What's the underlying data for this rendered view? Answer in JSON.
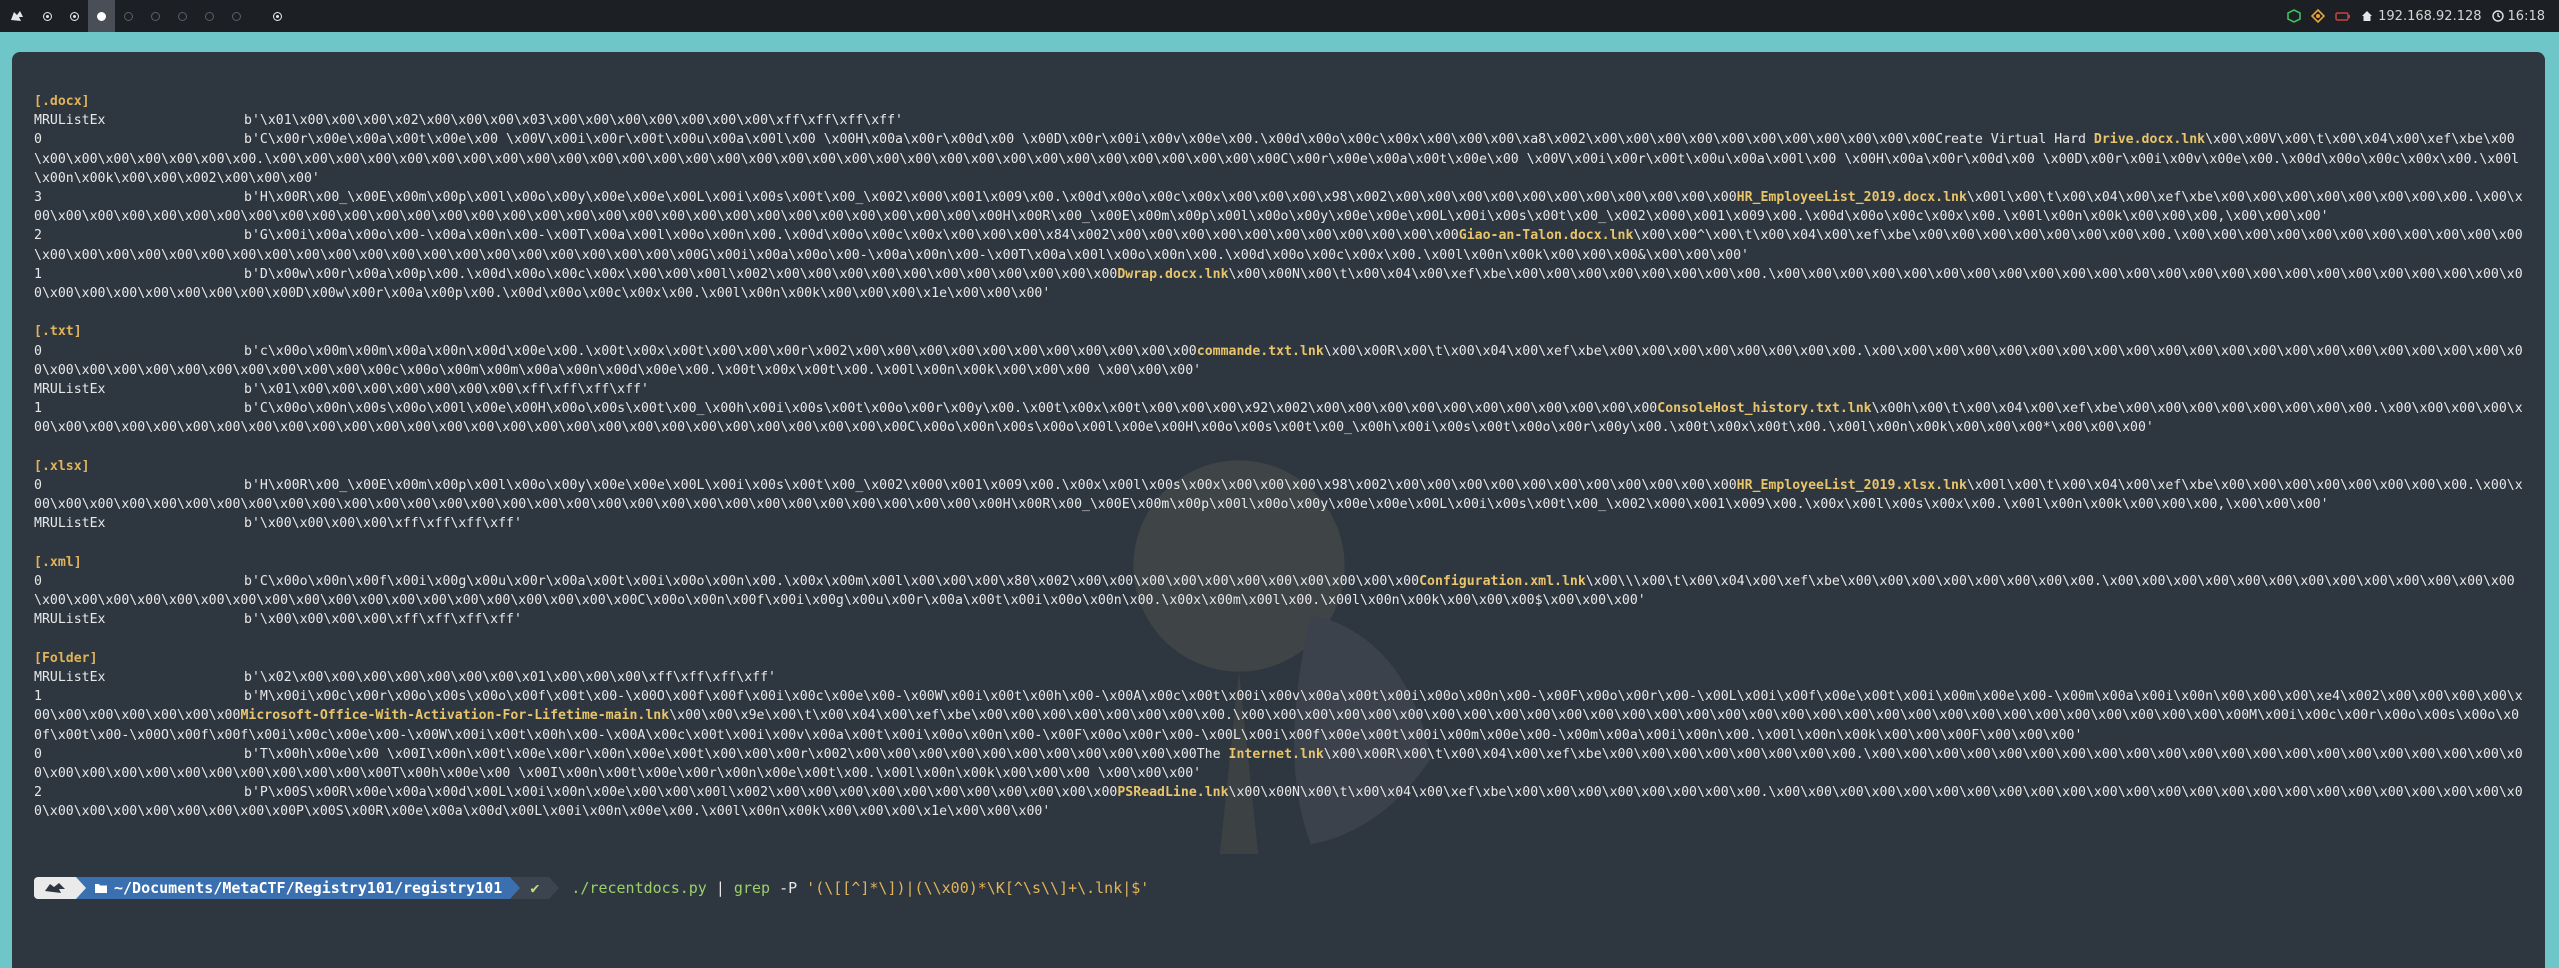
{
  "topbar": {
    "workspaces": [
      {
        "state": "filled"
      },
      {
        "state": "filled"
      },
      {
        "state": "active"
      },
      {
        "state": "empty"
      },
      {
        "state": "empty"
      },
      {
        "state": "empty"
      },
      {
        "state": "empty"
      },
      {
        "state": "empty"
      },
      {
        "state": "filled"
      }
    ],
    "ip": "192.168.92.128",
    "time": "16:18",
    "colors": {
      "bg": "#1c1f24",
      "green": "#3fbf5f",
      "orange": "#e8a23a",
      "red": "#c9433f"
    }
  },
  "terminal": {
    "sections": [
      {
        "title": "[.docx]",
        "rows": [
          {
            "key": "MRUListEx",
            "pre": "b'\\x01\\x00\\x00\\x00\\x02\\x00\\x00\\x00\\x03\\x00\\x00\\x00\\x00\\x00\\x00\\x00\\xff\\xff\\xff\\xff'",
            "lnk": "",
            "post": ""
          },
          {
            "key": "0",
            "pre": "b'C\\x00r\\x00e\\x00a\\x00t\\x00e\\x00 \\x00V\\x00i\\x00r\\x00t\\x00u\\x00a\\x00l\\x00 \\x00H\\x00a\\x00r\\x00d\\x00 \\x00D\\x00r\\x00i\\x00v\\x00e\\x00.\\x00d\\x00o\\x00c\\x00x\\x00\\x00\\x00\\xa8\\x002\\x00\\x00\\x00\\x00\\x00\\x00\\x00\\x00\\x00\\x00\\x00Create Virtual Hard ",
            "lnk": "Drive.docx.lnk",
            "post": "\\x00\\x00V\\x00\\t\\x00\\x04\\x00\\xef\\xbe\\x00\\x00\\x00\\x00\\x00\\x00\\x00\\x00.\\x00\\x00\\x00\\x00\\x00\\x00\\x00\\x00\\x00\\x00\\x00\\x00\\x00\\x00\\x00\\x00\\x00\\x00\\x00\\x00\\x00\\x00\\x00\\x00\\x00\\x00\\x00\\x00\\x00\\x00\\x00\\x00C\\x00r\\x00e\\x00a\\x00t\\x00e\\x00 \\x00V\\x00i\\x00r\\x00t\\x00u\\x00a\\x00l\\x00 \\x00H\\x00a\\x00r\\x00d\\x00 \\x00D\\x00r\\x00i\\x00v\\x00e\\x00.\\x00d\\x00o\\x00c\\x00x\\x00.\\x00l\\x00n\\x00k\\x00\\x00\\x002\\x00\\x00\\x00'"
          },
          {
            "key": "3",
            "pre": "b'H\\x00R\\x00_\\x00E\\x00m\\x00p\\x00l\\x00o\\x00y\\x00e\\x00e\\x00L\\x00i\\x00s\\x00t\\x00_\\x002\\x000\\x001\\x009\\x00.\\x00d\\x00o\\x00c\\x00x\\x00\\x00\\x00\\x98\\x002\\x00\\x00\\x00\\x00\\x00\\x00\\x00\\x00\\x00\\x00\\x00",
            "lnk": "HR_EmployeeList_2019.docx.lnk",
            "post": "\\x00l\\x00\\t\\x00\\x04\\x00\\xef\\xbe\\x00\\x00\\x00\\x00\\x00\\x00\\x00\\x00.\\x00\\x00\\x00\\x00\\x00\\x00\\x00\\x00\\x00\\x00\\x00\\x00\\x00\\x00\\x00\\x00\\x00\\x00\\x00\\x00\\x00\\x00\\x00\\x00\\x00\\x00\\x00\\x00\\x00\\x00\\x00\\x00H\\x00R\\x00_\\x00E\\x00m\\x00p\\x00l\\x00o\\x00y\\x00e\\x00e\\x00L\\x00i\\x00s\\x00t\\x00_\\x002\\x000\\x001\\x009\\x00.\\x00d\\x00o\\x00c\\x00x\\x00.\\x00l\\x00n\\x00k\\x00\\x00\\x00,\\x00\\x00\\x00'"
          },
          {
            "key": "2",
            "pre": "b'G\\x00i\\x00a\\x00o\\x00-\\x00a\\x00n\\x00-\\x00T\\x00a\\x00l\\x00o\\x00n\\x00.\\x00d\\x00o\\x00c\\x00x\\x00\\x00\\x00\\x84\\x002\\x00\\x00\\x00\\x00\\x00\\x00\\x00\\x00\\x00\\x00\\x00",
            "lnk": "Giao-an-Talon.docx.lnk",
            "post": "\\x00\\x00^\\x00\\t\\x00\\x04\\x00\\xef\\xbe\\x00\\x00\\x00\\x00\\x00\\x00\\x00\\x00.\\x00\\x00\\x00\\x00\\x00\\x00\\x00\\x00\\x00\\x00\\x00\\x00\\x00\\x00\\x00\\x00\\x00\\x00\\x00\\x00\\x00\\x00\\x00\\x00\\x00\\x00\\x00\\x00\\x00\\x00\\x00\\x00G\\x00i\\x00a\\x00o\\x00-\\x00a\\x00n\\x00-\\x00T\\x00a\\x00l\\x00o\\x00n\\x00.\\x00d\\x00o\\x00c\\x00x\\x00.\\x00l\\x00n\\x00k\\x00\\x00\\x00&\\x00\\x00\\x00'"
          },
          {
            "key": "1",
            "pre": "b'D\\x00w\\x00r\\x00a\\x00p\\x00.\\x00d\\x00o\\x00c\\x00x\\x00\\x00\\x00l\\x002\\x00\\x00\\x00\\x00\\x00\\x00\\x00\\x00\\x00\\x00\\x00",
            "lnk": "Dwrap.docx.lnk",
            "post": "\\x00\\x00N\\x00\\t\\x00\\x04\\x00\\xef\\xbe\\x00\\x00\\x00\\x00\\x00\\x00\\x00\\x00.\\x00\\x00\\x00\\x00\\x00\\x00\\x00\\x00\\x00\\x00\\x00\\x00\\x00\\x00\\x00\\x00\\x00\\x00\\x00\\x00\\x00\\x00\\x00\\x00\\x00\\x00\\x00\\x00\\x00\\x00\\x00\\x00D\\x00w\\x00r\\x00a\\x00p\\x00.\\x00d\\x00o\\x00c\\x00x\\x00.\\x00l\\x00n\\x00k\\x00\\x00\\x00\\x1e\\x00\\x00\\x00'"
          }
        ]
      },
      {
        "title": "[.txt]",
        "rows": [
          {
            "key": "0",
            "pre": "b'c\\x00o\\x00m\\x00m\\x00a\\x00n\\x00d\\x00e\\x00.\\x00t\\x00x\\x00t\\x00\\x00\\x00r\\x002\\x00\\x00\\x00\\x00\\x00\\x00\\x00\\x00\\x00\\x00\\x00",
            "lnk": "commande.txt.lnk",
            "post": "\\x00\\x00R\\x00\\t\\x00\\x04\\x00\\xef\\xbe\\x00\\x00\\x00\\x00\\x00\\x00\\x00\\x00.\\x00\\x00\\x00\\x00\\x00\\x00\\x00\\x00\\x00\\x00\\x00\\x00\\x00\\x00\\x00\\x00\\x00\\x00\\x00\\x00\\x00\\x00\\x00\\x00\\x00\\x00\\x00\\x00\\x00\\x00\\x00\\x00c\\x00o\\x00m\\x00m\\x00a\\x00n\\x00d\\x00e\\x00.\\x00t\\x00x\\x00t\\x00.\\x00l\\x00n\\x00k\\x00\\x00\\x00 \\x00\\x00\\x00'"
          },
          {
            "key": "MRUListEx",
            "pre": "b'\\x01\\x00\\x00\\x00\\x00\\x00\\x00\\x00\\xff\\xff\\xff\\xff'",
            "lnk": "",
            "post": ""
          },
          {
            "key": "1",
            "pre": "b'C\\x00o\\x00n\\x00s\\x00o\\x00l\\x00e\\x00H\\x00o\\x00s\\x00t\\x00_\\x00h\\x00i\\x00s\\x00t\\x00o\\x00r\\x00y\\x00.\\x00t\\x00x\\x00t\\x00\\x00\\x00\\x92\\x002\\x00\\x00\\x00\\x00\\x00\\x00\\x00\\x00\\x00\\x00\\x00",
            "lnk": "ConsoleHost_history.txt.lnk",
            "post": "\\x00h\\x00\\t\\x00\\x04\\x00\\xef\\xbe\\x00\\x00\\x00\\x00\\x00\\x00\\x00\\x00.\\x00\\x00\\x00\\x00\\x00\\x00\\x00\\x00\\x00\\x00\\x00\\x00\\x00\\x00\\x00\\x00\\x00\\x00\\x00\\x00\\x00\\x00\\x00\\x00\\x00\\x00\\x00\\x00\\x00\\x00\\x00\\x00C\\x00o\\x00n\\x00s\\x00o\\x00l\\x00e\\x00H\\x00o\\x00s\\x00t\\x00_\\x00h\\x00i\\x00s\\x00t\\x00o\\x00r\\x00y\\x00.\\x00t\\x00x\\x00t\\x00.\\x00l\\x00n\\x00k\\x00\\x00\\x00*\\x00\\x00\\x00'"
          }
        ]
      },
      {
        "title": "[.xlsx]",
        "rows": [
          {
            "key": "0",
            "pre": "b'H\\x00R\\x00_\\x00E\\x00m\\x00p\\x00l\\x00o\\x00y\\x00e\\x00e\\x00L\\x00i\\x00s\\x00t\\x00_\\x002\\x000\\x001\\x009\\x00.\\x00x\\x00l\\x00s\\x00x\\x00\\x00\\x00\\x98\\x002\\x00\\x00\\x00\\x00\\x00\\x00\\x00\\x00\\x00\\x00\\x00",
            "lnk": "HR_EmployeeList_2019.xlsx.lnk",
            "post": "\\x00l\\x00\\t\\x00\\x04\\x00\\xef\\xbe\\x00\\x00\\x00\\x00\\x00\\x00\\x00\\x00.\\x00\\x00\\x00\\x00\\x00\\x00\\x00\\x00\\x00\\x00\\x00\\x00\\x00\\x00\\x00\\x00\\x00\\x00\\x00\\x00\\x00\\x00\\x00\\x00\\x00\\x00\\x00\\x00\\x00\\x00\\x00\\x00H\\x00R\\x00_\\x00E\\x00m\\x00p\\x00l\\x00o\\x00y\\x00e\\x00e\\x00L\\x00i\\x00s\\x00t\\x00_\\x002\\x000\\x001\\x009\\x00.\\x00x\\x00l\\x00s\\x00x\\x00.\\x00l\\x00n\\x00k\\x00\\x00\\x00,\\x00\\x00\\x00'"
          },
          {
            "key": "MRUListEx",
            "pre": "b'\\x00\\x00\\x00\\x00\\xff\\xff\\xff\\xff'",
            "lnk": "",
            "post": ""
          }
        ]
      },
      {
        "title": "[.xml]",
        "rows": [
          {
            "key": "0",
            "pre": "b'C\\x00o\\x00n\\x00f\\x00i\\x00g\\x00u\\x00r\\x00a\\x00t\\x00i\\x00o\\x00n\\x00.\\x00x\\x00m\\x00l\\x00\\x00\\x00\\x80\\x002\\x00\\x00\\x00\\x00\\x00\\x00\\x00\\x00\\x00\\x00\\x00",
            "lnk": "Configuration.xml.lnk",
            "post": "\\x00\\\\\\x00\\t\\x00\\x04\\x00\\xef\\xbe\\x00\\x00\\x00\\x00\\x00\\x00\\x00\\x00.\\x00\\x00\\x00\\x00\\x00\\x00\\x00\\x00\\x00\\x00\\x00\\x00\\x00\\x00\\x00\\x00\\x00\\x00\\x00\\x00\\x00\\x00\\x00\\x00\\x00\\x00\\x00\\x00\\x00\\x00\\x00\\x00C\\x00o\\x00n\\x00f\\x00i\\x00g\\x00u\\x00r\\x00a\\x00t\\x00i\\x00o\\x00n\\x00.\\x00x\\x00m\\x00l\\x00.\\x00l\\x00n\\x00k\\x00\\x00\\x00$\\x00\\x00\\x00'"
          },
          {
            "key": "MRUListEx",
            "pre": "b'\\x00\\x00\\x00\\x00\\xff\\xff\\xff\\xff'",
            "lnk": "",
            "post": ""
          }
        ]
      },
      {
        "title": "[Folder]",
        "rows": [
          {
            "key": "MRUListEx",
            "pre": "b'\\x02\\x00\\x00\\x00\\x00\\x00\\x00\\x00\\x01\\x00\\x00\\x00\\xff\\xff\\xff\\xff'",
            "lnk": "",
            "post": ""
          },
          {
            "key": "1",
            "pre": "b'M\\x00i\\x00c\\x00r\\x00o\\x00s\\x00o\\x00f\\x00t\\x00-\\x00O\\x00f\\x00f\\x00i\\x00c\\x00e\\x00-\\x00W\\x00i\\x00t\\x00h\\x00-\\x00A\\x00c\\x00t\\x00i\\x00v\\x00a\\x00t\\x00i\\x00o\\x00n\\x00-\\x00F\\x00o\\x00r\\x00-\\x00L\\x00i\\x00f\\x00e\\x00t\\x00i\\x00m\\x00e\\x00-\\x00m\\x00a\\x00i\\x00n\\x00\\x00\\x00\\xe4\\x002\\x00\\x00\\x00\\x00\\x00\\x00\\x00\\x00\\x00\\x00\\x00",
            "lnk": "Microsoft-Office-With-Activation-For-Lifetime-main.lnk",
            "post": "\\x00\\x00\\x9e\\x00\\t\\x00\\x04\\x00\\xef\\xbe\\x00\\x00\\x00\\x00\\x00\\x00\\x00\\x00.\\x00\\x00\\x00\\x00\\x00\\x00\\x00\\x00\\x00\\x00\\x00\\x00\\x00\\x00\\x00\\x00\\x00\\x00\\x00\\x00\\x00\\x00\\x00\\x00\\x00\\x00\\x00\\x00\\x00\\x00\\x00\\x00M\\x00i\\x00c\\x00r\\x00o\\x00s\\x00o\\x00f\\x00t\\x00-\\x00O\\x00f\\x00f\\x00i\\x00c\\x00e\\x00-\\x00W\\x00i\\x00t\\x00h\\x00-\\x00A\\x00c\\x00t\\x00i\\x00v\\x00a\\x00t\\x00i\\x00o\\x00n\\x00-\\x00F\\x00o\\x00r\\x00-\\x00L\\x00i\\x00f\\x00e\\x00t\\x00i\\x00m\\x00e\\x00-\\x00m\\x00a\\x00i\\x00n\\x00.\\x00l\\x00n\\x00k\\x00\\x00\\x00F\\x00\\x00\\x00'"
          },
          {
            "key": "0",
            "pre": "b'T\\x00h\\x00e\\x00 \\x00I\\x00n\\x00t\\x00e\\x00r\\x00n\\x00e\\x00t\\x00\\x00\\x00r\\x002\\x00\\x00\\x00\\x00\\x00\\x00\\x00\\x00\\x00\\x00\\x00The ",
            "lnk": "Internet.lnk",
            "post": "\\x00\\x00R\\x00\\t\\x00\\x04\\x00\\xef\\xbe\\x00\\x00\\x00\\x00\\x00\\x00\\x00\\x00.\\x00\\x00\\x00\\x00\\x00\\x00\\x00\\x00\\x00\\x00\\x00\\x00\\x00\\x00\\x00\\x00\\x00\\x00\\x00\\x00\\x00\\x00\\x00\\x00\\x00\\x00\\x00\\x00\\x00\\x00\\x00\\x00T\\x00h\\x00e\\x00 \\x00I\\x00n\\x00t\\x00e\\x00r\\x00n\\x00e\\x00t\\x00.\\x00l\\x00n\\x00k\\x00\\x00\\x00 \\x00\\x00\\x00'"
          },
          {
            "key": "2",
            "pre": "b'P\\x00S\\x00R\\x00e\\x00a\\x00d\\x00L\\x00i\\x00n\\x00e\\x00\\x00\\x00l\\x002\\x00\\x00\\x00\\x00\\x00\\x00\\x00\\x00\\x00\\x00\\x00",
            "lnk": "PSReadLine.lnk",
            "post": "\\x00\\x00N\\x00\\t\\x00\\x04\\x00\\xef\\xbe\\x00\\x00\\x00\\x00\\x00\\x00\\x00\\x00.\\x00\\x00\\x00\\x00\\x00\\x00\\x00\\x00\\x00\\x00\\x00\\x00\\x00\\x00\\x00\\x00\\x00\\x00\\x00\\x00\\x00\\x00\\x00\\x00\\x00\\x00\\x00\\x00\\x00\\x00\\x00\\x00P\\x00S\\x00R\\x00e\\x00a\\x00d\\x00L\\x00i\\x00n\\x00e\\x00.\\x00l\\x00n\\x00k\\x00\\x00\\x00\\x1e\\x00\\x00\\x00'"
          }
        ]
      }
    ]
  },
  "prompt": {
    "path_prefix": "~/Documents/MetaCTF/Registry101/",
    "path_dir": "registry101",
    "status": "✔",
    "command": "./recentdocs.py",
    "pipe": "|",
    "grep": "grep",
    "flag": "-P",
    "pattern": "'(\\[[^]*\\])|(\\\\x00)*\\K[^\\s\\\\]+\\.lnk|$'"
  }
}
